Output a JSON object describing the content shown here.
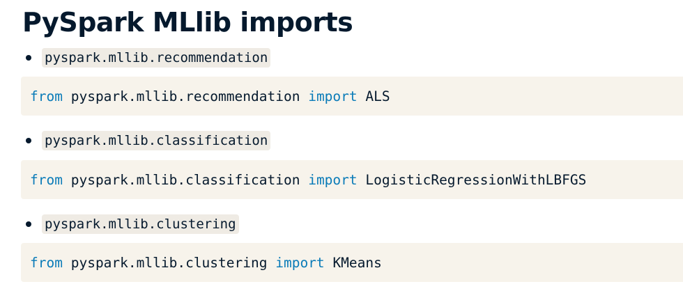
{
  "title": "PySpark MLlib imports",
  "colors": {
    "text": "#05192d",
    "keyword": "#0a7bb8",
    "code_block_bg": "#f7f3eb",
    "inline_code_bg": "#efebe4"
  },
  "items": [
    {
      "module": "pyspark.mllib.recommendation",
      "code": {
        "kw_from": "from",
        "module": "pyspark.mllib.recommendation",
        "kw_import": "import",
        "name": "ALS"
      }
    },
    {
      "module": "pyspark.mllib.classification",
      "code": {
        "kw_from": "from",
        "module": "pyspark.mllib.classification",
        "kw_import": "import",
        "name": "LogisticRegressionWithLBFGS"
      }
    },
    {
      "module": "pyspark.mllib.clustering",
      "code": {
        "kw_from": "from",
        "module": "pyspark.mllib.clustering",
        "kw_import": "import",
        "name": "KMeans"
      }
    }
  ]
}
